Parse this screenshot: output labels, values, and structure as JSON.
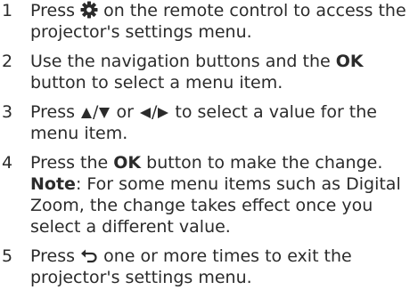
{
  "steps": [
    {
      "number": "1",
      "before": "Press ",
      "icon": "settings-icon",
      "after": " on the remote control to access the projector's settings menu."
    },
    {
      "number": "2",
      "before": "Use the navigation buttons and the ",
      "bold": "OK",
      "after": " button to select a menu item."
    },
    {
      "number": "3",
      "before": "Press ",
      "mid1": "/",
      "mid2": " or ",
      "mid3": "/",
      "after": " to select a value for the menu item.",
      "icons": [
        "triangle-up-icon",
        "triangle-down-icon",
        "triangle-left-icon",
        "triangle-right-icon"
      ]
    },
    {
      "number": "4",
      "before": "Press the ",
      "bold": "OK",
      "after": " button to make the change.",
      "note_label": "Note",
      "note_text": ": For some menu items such as Digital Zoom, the change takes effect once you select a different value."
    },
    {
      "number": "5",
      "before": "Press ",
      "icon": "back-icon",
      "after": " one or more times to exit the projector's settings menu."
    }
  ],
  "colors": {
    "text": "#2b2b2b",
    "background": "#ffffff"
  }
}
